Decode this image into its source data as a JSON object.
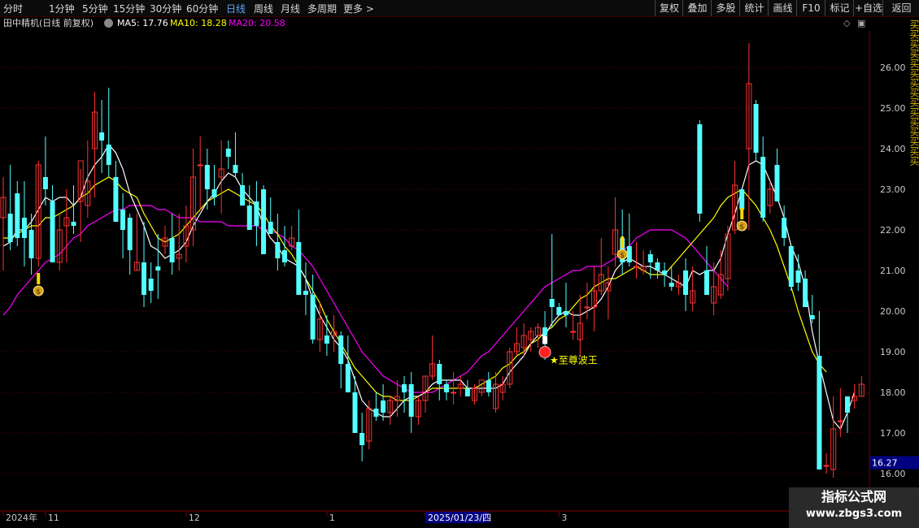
{
  "toolbar": {
    "periods": [
      "分时",
      "1分钟",
      "5分钟",
      "15分钟",
      "30分钟",
      "60分钟",
      "日线",
      "周线",
      "月线",
      "多周期",
      "更多 >"
    ],
    "active_period": "日线",
    "right_buttons": [
      "复权",
      "叠加",
      "多股",
      "统计",
      "画线",
      "F10",
      "标记",
      "+自选",
      "返回"
    ]
  },
  "info": {
    "title": "田中精机(日线 前复权)",
    "ma5_label": "MA5: 17.76",
    "ma10_label": "MA10: 18.28",
    "ma20_label": "MA20: 20.58"
  },
  "colors": {
    "up": "#ff3232",
    "down": "#54ffff",
    "ma5": "#ffffff",
    "ma10": "#ffff00",
    "ma20": "#ff00ff",
    "grid": "#5a0000",
    "axis_text": "#c8c8c8",
    "price_tag_bg": "#000080"
  },
  "axis": {
    "y_ticks": [
      "16.00",
      "17.00",
      "18.00",
      "19.00",
      "20.00",
      "21.00",
      "22.00",
      "23.00",
      "24.00",
      "25.00",
      "26.00"
    ],
    "current_price": "16.27",
    "date_labels": [
      {
        "text": "2024年",
        "bar": 0
      },
      {
        "text": "11",
        "bar": 6
      },
      {
        "text": "12",
        "bar": 26
      },
      {
        "text": "1",
        "bar": 46
      },
      {
        "text": "2025/01/23/四",
        "bar": 60
      },
      {
        "text": "3",
        "bar": 79
      }
    ]
  },
  "annotation": {
    "signal_label": "至尊波王"
  },
  "watermark": {
    "line1": "指标公式网",
    "line2": "www.zbgs3.com"
  },
  "side_text": "买买买买买买买买买买买买买买买",
  "chart_data": {
    "type": "candlestick",
    "ylim": [
      15.1,
      26.9
    ],
    "series": [
      {
        "name": "MA5",
        "label": "MA5: 17.76"
      },
      {
        "name": "MA10",
        "label": "MA10: 18.28"
      },
      {
        "name": "MA20",
        "label": "MA20: 20.58"
      }
    ],
    "candles": [
      [
        22.3,
        23.3,
        21.0,
        22.8
      ],
      [
        22.4,
        23.6,
        21.5,
        21.7
      ],
      [
        22.9,
        23.2,
        21.6,
        21.8
      ],
      [
        22.3,
        23.2,
        21.1,
        21.8
      ],
      [
        22.0,
        22.4,
        20.9,
        21.3
      ],
      [
        21.3,
        23.7,
        21.1,
        23.6
      ],
      [
        23.3,
        24.3,
        22.6,
        23.0
      ],
      [
        22.7,
        23.1,
        21.3,
        21.2
      ],
      [
        21.2,
        22.4,
        21.0,
        22.0
      ],
      [
        22.1,
        23.0,
        21.2,
        22.3
      ],
      [
        22.2,
        23.1,
        21.9,
        22.1
      ],
      [
        22.7,
        23.5,
        21.7,
        23.7
      ],
      [
        22.6,
        24.2,
        22.3,
        23.2
      ],
      [
        24.0,
        25.4,
        22.8,
        24.9
      ],
      [
        24.4,
        25.2,
        23.4,
        24.2
      ],
      [
        24.1,
        25.5,
        23.3,
        23.6
      ],
      [
        23.3,
        23.7,
        22.4,
        22.2
      ],
      [
        22.5,
        22.9,
        21.3,
        22.0
      ],
      [
        22.3,
        22.4,
        20.9,
        21.5
      ],
      [
        21.0,
        22.4,
        21.0,
        21.2
      ],
      [
        21.2,
        22.2,
        20.1,
        20.4
      ],
      [
        20.8,
        21.2,
        20.2,
        20.5
      ],
      [
        21.1,
        21.9,
        20.3,
        21.0
      ],
      [
        21.6,
        22.1,
        21.4,
        21.8
      ],
      [
        21.8,
        22.4,
        20.9,
        21.2
      ],
      [
        21.3,
        22.4,
        21.0,
        21.4
      ],
      [
        21.6,
        22.6,
        21.2,
        22.1
      ],
      [
        22.0,
        24.0,
        21.6,
        23.3
      ],
      [
        23.6,
        24.3,
        22.5,
        23.6
      ],
      [
        23.6,
        24.0,
        22.5,
        23.0
      ],
      [
        23.0,
        23.6,
        22.6,
        22.8
      ],
      [
        23.3,
        24.2,
        22.4,
        23.5
      ],
      [
        24.0,
        24.2,
        23.5,
        23.8
      ],
      [
        23.6,
        24.4,
        23.3,
        23.4
      ],
      [
        23.1,
        23.4,
        22.6,
        22.6
      ],
      [
        22.6,
        23.1,
        22.0,
        22.0
      ],
      [
        22.7,
        23.2,
        21.6,
        22.1
      ],
      [
        23.0,
        23.1,
        21.7,
        21.4
      ],
      [
        22.2,
        22.8,
        21.9,
        21.9
      ],
      [
        21.7,
        22.4,
        21.0,
        21.3
      ],
      [
        21.5,
        22.1,
        21.1,
        21.2
      ],
      [
        21.6,
        22.1,
        21.5,
        21.8
      ],
      [
        21.7,
        22.5,
        20.4,
        20.4
      ],
      [
        20.5,
        21.2,
        19.9,
        20.4
      ],
      [
        20.4,
        20.9,
        19.2,
        19.3
      ],
      [
        19.3,
        20.2,
        19.0,
        19.8
      ],
      [
        19.4,
        19.9,
        18.9,
        19.2
      ],
      [
        19.4,
        19.9,
        19.0,
        19.5
      ],
      [
        19.4,
        19.5,
        18.1,
        18.7
      ],
      [
        18.7,
        19.4,
        18.2,
        18.0
      ],
      [
        18.0,
        18.4,
        17.0,
        17.0
      ],
      [
        17.0,
        17.5,
        16.3,
        16.7
      ],
      [
        16.8,
        17.8,
        16.6,
        17.6
      ],
      [
        17.6,
        18.0,
        17.3,
        17.4
      ],
      [
        17.8,
        18.2,
        17.3,
        17.5
      ],
      [
        17.5,
        17.9,
        17.2,
        17.8
      ],
      [
        17.8,
        18.3,
        17.4,
        17.9
      ],
      [
        18.2,
        18.4,
        17.5,
        18.0
      ],
      [
        18.2,
        18.5,
        17.0,
        17.4
      ],
      [
        17.4,
        17.9,
        17.2,
        17.8
      ],
      [
        17.8,
        18.4,
        17.5,
        18.4
      ],
      [
        18.4,
        19.4,
        18.3,
        18.7
      ],
      [
        18.7,
        18.8,
        17.8,
        18.2
      ],
      [
        18.2,
        18.3,
        17.8,
        18.0
      ],
      [
        18.0,
        18.5,
        17.7,
        18.0
      ],
      [
        18.1,
        18.4,
        17.9,
        18.2
      ],
      [
        18.1,
        18.3,
        17.9,
        17.9
      ],
      [
        17.8,
        18.2,
        17.7,
        18.1
      ],
      [
        18.0,
        18.2,
        17.9,
        18.3
      ],
      [
        18.3,
        18.5,
        17.9,
        18.0
      ],
      [
        17.6,
        18.5,
        17.5,
        18.2
      ],
      [
        18.0,
        18.4,
        17.8,
        18.2
      ],
      [
        18.2,
        19.1,
        18.1,
        19.0
      ],
      [
        19.0,
        19.6,
        18.9,
        19.2
      ],
      [
        19.1,
        19.7,
        18.9,
        19.4
      ],
      [
        19.3,
        19.6,
        19.0,
        19.5
      ],
      [
        19.4,
        19.7,
        19.1,
        19.6
      ],
      [
        19.6,
        20.0,
        18.8,
        19.4
      ],
      [
        20.3,
        21.9,
        19.6,
        20.1
      ],
      [
        20.1,
        20.2,
        19.9,
        19.9
      ],
      [
        20.0,
        20.7,
        19.6,
        19.9
      ],
      [
        19.5,
        20.0,
        19.3,
        19.5
      ],
      [
        19.3,
        20.4,
        18.9,
        19.7
      ],
      [
        20.1,
        20.7,
        19.8,
        20.1
      ],
      [
        20.1,
        21.1,
        19.5,
        20.5
      ],
      [
        20.5,
        21.8,
        20.4,
        20.9
      ],
      [
        20.5,
        21.1,
        19.8,
        20.7
      ],
      [
        21.4,
        22.8,
        21.1,
        22.0
      ],
      [
        21.8,
        22.5,
        20.9,
        21.2
      ],
      [
        21.6,
        22.4,
        21.1,
        21.2
      ],
      [
        21.1,
        21.7,
        20.8,
        21.1
      ],
      [
        21.0,
        21.5,
        20.9,
        21.1
      ],
      [
        21.4,
        21.5,
        20.8,
        21.2
      ],
      [
        21.2,
        21.3,
        20.8,
        21.0
      ],
      [
        21.0,
        21.2,
        20.6,
        20.9
      ],
      [
        20.7,
        21.1,
        20.5,
        20.6
      ],
      [
        20.6,
        20.9,
        20.4,
        20.7
      ],
      [
        21.0,
        21.3,
        20.0,
        20.4
      ],
      [
        20.2,
        21.1,
        20.0,
        20.5
      ],
      [
        24.6,
        24.7,
        22.2,
        22.4
      ],
      [
        21.0,
        21.6,
        20.5,
        20.4
      ],
      [
        20.2,
        21.2,
        19.9,
        20.6
      ],
      [
        20.4,
        21.5,
        20.3,
        20.9
      ],
      [
        20.8,
        22.1,
        20.5,
        21.9
      ],
      [
        22.0,
        23.7,
        21.9,
        23.1
      ],
      [
        23.0,
        22.9,
        22.3,
        22.5
      ],
      [
        24.0,
        26.6,
        22.0,
        25.6
      ],
      [
        25.1,
        25.2,
        23.7,
        23.9
      ],
      [
        23.8,
        24.3,
        22.2,
        22.3
      ],
      [
        22.6,
        23.2,
        22.4,
        23.0
      ],
      [
        23.6,
        24.0,
        22.8,
        22.7
      ],
      [
        22.3,
        22.6,
        21.6,
        21.8
      ],
      [
        21.6,
        21.6,
        20.5,
        20.6
      ],
      [
        21.0,
        21.4,
        20.5,
        20.7
      ],
      [
        20.8,
        21.0,
        20.1,
        20.1
      ],
      [
        19.9,
        20.4,
        19.7,
        19.8
      ],
      [
        18.9,
        20.0,
        16.3,
        16.1
      ],
      [
        16.2,
        16.5,
        16.0,
        16.2
      ],
      [
        16.1,
        17.9,
        15.9,
        17.1
      ],
      [
        17.3,
        18.1,
        16.9,
        17.3
      ],
      [
        17.9,
        17.9,
        17.0,
        17.5
      ],
      [
        17.8,
        18.2,
        17.6,
        17.9
      ],
      [
        17.9,
        18.4,
        17.9,
        18.2
      ]
    ],
    "ma_lines": {
      "MA5": [
        21.6,
        21.7,
        22.0,
        22.0,
        22.2,
        22.5,
        22.8,
        22.7,
        22.8,
        22.8,
        22.6,
        22.8,
        23.3,
        23.6,
        23.8,
        24.1,
        23.9,
        23.5,
        22.9,
        22.5,
        22.1,
        21.6,
        21.5,
        21.3,
        21.4,
        21.5,
        21.7,
        22.1,
        22.4,
        22.7,
        22.9,
        23.2,
        23.4,
        23.3,
        23.0,
        22.8,
        22.6,
        22.1,
        21.8,
        21.6,
        21.3,
        21.2,
        21.1,
        20.8,
        20.3,
        19.9,
        19.6,
        19.3,
        19.1,
        18.8,
        18.3,
        17.8,
        17.6,
        17.5,
        17.4,
        17.4,
        17.6,
        17.8,
        17.9,
        17.9,
        18.0,
        18.2,
        18.3,
        18.3,
        18.3,
        18.3,
        18.1,
        18.1,
        18.1,
        18.1,
        18.1,
        18.2,
        18.5,
        18.7,
        18.9,
        19.2,
        19.4,
        19.4,
        19.7,
        19.9,
        20.0,
        19.9,
        19.9,
        20.0,
        20.1,
        20.3,
        20.6,
        21.0,
        21.2,
        21.3,
        21.2,
        21.1,
        21.1,
        21.0,
        20.9,
        20.8,
        20.7,
        20.6,
        21.0,
        20.9,
        21.0,
        21.0,
        21.3,
        21.9,
        22.4,
        23.0,
        23.6,
        23.7,
        23.6,
        23.2,
        22.8,
        22.3,
        21.6,
        21.2,
        20.6,
        19.5,
        18.7,
        18.0,
        17.3,
        17.1,
        17.5,
        18.0
      ],
      "MA10": [
        21.8,
        21.8,
        21.9,
        22.0,
        22.1,
        22.1,
        22.3,
        22.3,
        22.4,
        22.5,
        22.6,
        22.8,
        22.9,
        23.1,
        23.2,
        23.3,
        23.2,
        23.0,
        22.9,
        22.8,
        22.4,
        22.1,
        21.8,
        21.7,
        21.8,
        21.9,
        22.1,
        22.3,
        22.5,
        22.7,
        22.8,
        22.9,
        23.0,
        22.9,
        22.8,
        22.7,
        22.6,
        22.4,
        22.1,
        21.9,
        21.6,
        21.4,
        21.1,
        20.8,
        20.5,
        20.2,
        19.8,
        19.5,
        19.2,
        18.9,
        18.6,
        18.4,
        18.2,
        18.0,
        17.9,
        17.9,
        17.8,
        17.8,
        17.8,
        17.9,
        18.0,
        18.1,
        18.1,
        18.1,
        18.1,
        18.1,
        18.1,
        18.1,
        18.2,
        18.3,
        18.4,
        18.6,
        18.7,
        18.9,
        19.0,
        19.2,
        19.3,
        19.5,
        19.6,
        19.8,
        19.9,
        20.1,
        20.3,
        20.4,
        20.6,
        20.7,
        20.8,
        20.8,
        20.9,
        21.0,
        21.1,
        21.0,
        20.9,
        20.9,
        20.9,
        21.1,
        21.3,
        21.5,
        21.7,
        21.9,
        22.1,
        22.3,
        22.6,
        22.8,
        22.9,
        23.0,
        22.8,
        22.6,
        22.3,
        22.0,
        21.6,
        21.1,
        20.6,
        20.0,
        19.5,
        19.0,
        18.7,
        18.5
      ]
    },
    "ma20_line": [
      19.9,
      20.1,
      20.4,
      20.6,
      20.8,
      21.0,
      21.2,
      21.3,
      21.4,
      21.6,
      21.8,
      21.9,
      22.1,
      22.2,
      22.3,
      22.4,
      22.5,
      22.5,
      22.6,
      22.6,
      22.6,
      22.6,
      22.5,
      22.5,
      22.4,
      22.3,
      22.3,
      22.3,
      22.2,
      22.2,
      22.2,
      22.2,
      22.1,
      22.1,
      22.1,
      22.1,
      22.1,
      22.0,
      22.0,
      21.9,
      21.8,
      21.6,
      21.5,
      21.3,
      21.1,
      20.8,
      20.5,
      20.2,
      19.9,
      19.6,
      19.3,
      19.0,
      18.8,
      18.6,
      18.4,
      18.3,
      18.2,
      18.1,
      18.0,
      18.0,
      18.0,
      18.0,
      18.1,
      18.2,
      18.3,
      18.4,
      18.5,
      18.7,
      18.9,
      19.0,
      19.2,
      19.4,
      19.6,
      19.8,
      20.0,
      20.2,
      20.4,
      20.6,
      20.7,
      20.8,
      20.9,
      21.0,
      21.0,
      21.1,
      21.1,
      21.1,
      21.2,
      21.3,
      21.5,
      21.6,
      21.8,
      21.9,
      22.0,
      22.0,
      22.0,
      22.0,
      21.9,
      21.8,
      21.6,
      21.4,
      21.2,
      21.0,
      20.8,
      20.6
    ],
    "signals": [
      {
        "type": "money",
        "bar": 5,
        "price": 20.5
      },
      {
        "type": "money",
        "bar": 88,
        "price": 21.4
      },
      {
        "type": "money",
        "bar": 105,
        "price": 22.1
      },
      {
        "type": "buy",
        "bar": 77,
        "price": 18.99
      }
    ]
  }
}
